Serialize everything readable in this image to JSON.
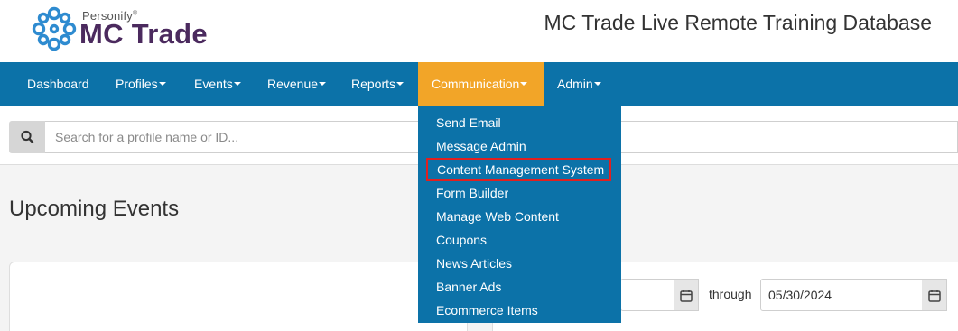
{
  "header": {
    "logo_brand": "Personify",
    "logo_brand_mark": "®",
    "logo_product": "MC Trade",
    "site_title": "MC Trade Live Remote Training Database"
  },
  "nav": {
    "items": [
      {
        "label": "Dashboard",
        "has_caret": false
      },
      {
        "label": "Profiles",
        "has_caret": true
      },
      {
        "label": "Events",
        "has_caret": true
      },
      {
        "label": "Revenue",
        "has_caret": true
      },
      {
        "label": "Reports",
        "has_caret": true
      },
      {
        "label": "Communication",
        "has_caret": true,
        "active": true
      },
      {
        "label": "Admin",
        "has_caret": true
      }
    ]
  },
  "search": {
    "placeholder": "Search for a profile name or ID...",
    "icon": "search-icon"
  },
  "communication_menu": {
    "items": [
      {
        "label": "Send Email"
      },
      {
        "label": "Message Admin"
      },
      {
        "label": "Content Management System",
        "highlighted": true
      },
      {
        "label": "Form Builder"
      },
      {
        "label": "Manage Web Content"
      },
      {
        "label": "Coupons"
      },
      {
        "label": "News Articles"
      },
      {
        "label": "Banner Ads"
      },
      {
        "label": "Ecommerce Items"
      }
    ]
  },
  "main": {
    "title": "Upcoming Events",
    "date_range": {
      "from_value": "",
      "through_label": "through",
      "to_value": "05/30/2024"
    }
  },
  "colors": {
    "nav_bg": "#0c72a8",
    "nav_active": "#f2a528",
    "brand_purple": "#4b2a5e",
    "logo_blue": "#2e8bd0",
    "highlight_border": "#e02020"
  }
}
